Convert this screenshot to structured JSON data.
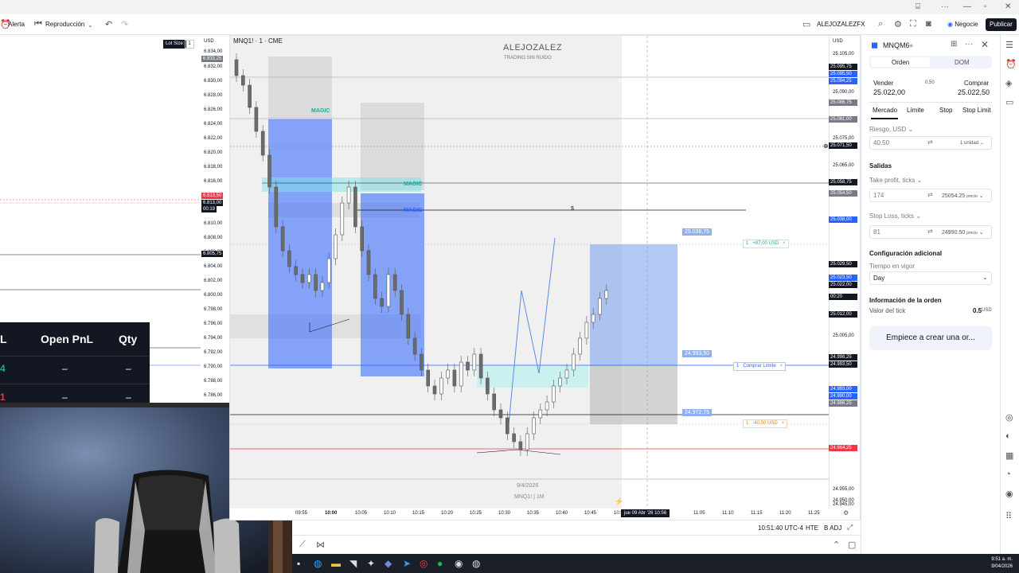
{
  "toolbar": {
    "alert_label": "Alerta",
    "replay_label": "Reproducción",
    "account_label": "ALEJOZALEZFX",
    "trade_label": "Negocie",
    "publish_label": "Publicar"
  },
  "left_chart": {
    "lot_label": "Lot Size:",
    "lot_value": "1",
    "currency": "USD",
    "prices": [
      "6.834,00",
      "6.832,00",
      "6.830,00",
      "6.828,00",
      "6.826,00",
      "6.824,00",
      "6.822,00",
      "6.820,00",
      "6.818,00",
      "6.816,00",
      "6.810,00",
      "6.808,00",
      "6.806,00",
      "6.804,00",
      "6.802,00",
      "6.800,00",
      "6.798,00",
      "6.796,00",
      "6.794,00",
      "6.792,00",
      "6.790,00",
      "6.788,00",
      "6.786,00"
    ],
    "tags": {
      "top": "6.833,25",
      "red": "6.813,50",
      "last": "6.813,00",
      "countdown": "00:19",
      "black": "6.805,75"
    },
    "pnl": {
      "col1": "L",
      "col2": "Open PnL",
      "col3": "Qty",
      "row1": [
        "4",
        "–",
        "–"
      ],
      "row2": [
        "1",
        "–",
        "–"
      ]
    }
  },
  "main_chart": {
    "title": "MNQ1! · 1 · CME",
    "watermark_title": "ALEJOZALEZ",
    "watermark_sub": "TRADING SIN RUIDO",
    "watermark_date": "9/4/2026",
    "watermark_symbol": "MNQ1! | 1M",
    "currency": "USD",
    "zone_labels": [
      "MAGIC",
      "MAGIC",
      "MAGIC"
    ],
    "level_label": "$",
    "price_labels": {
      "target": "25.036,75",
      "entry": "24.993,50",
      "stop": "24.972,75"
    },
    "order_labels": {
      "tp_qty": "1",
      "tp_text": "+87,00 USD",
      "limit_qty": "1",
      "limit_text": "Comprar Límite",
      "sl_qty": "1",
      "sl_text": "-40,50 USD",
      "close": "×"
    },
    "axis_prices": [
      "25.105,00",
      "25.090,00",
      "25.075,00",
      "25.065,00",
      "25.030,00",
      "25.020,00",
      "25.005,00",
      "24.955,00",
      "24.950,00",
      "24.945,00"
    ],
    "axis_tags": [
      {
        "text": "25.095,75",
        "color": "#131722"
      },
      {
        "text": "25.095,50",
        "color": "#2962ff"
      },
      {
        "text": "25.094,25",
        "color": "#2962ff"
      },
      {
        "text": "25.086,75",
        "color": "#787b86"
      },
      {
        "text": "25.081,00",
        "color": "#787b86"
      },
      {
        "text": "25.071,50",
        "color": "#131722"
      },
      {
        "text": "25.058,75",
        "color": "#131722"
      },
      {
        "text": "25.054,50",
        "color": "#787b86"
      },
      {
        "text": "25.038,00",
        "color": "#2962ff"
      },
      {
        "text": "25.029,50",
        "color": "#131722"
      },
      {
        "text": "25.023,50",
        "color": "#2962ff"
      },
      {
        "text": "25.022,00",
        "color": "#131722"
      },
      {
        "text": "25.012,00",
        "color": "#131722"
      },
      {
        "text": "24.998,25",
        "color": "#131722"
      },
      {
        "text": "24.993,50",
        "color": "#131722"
      },
      {
        "text": "24.993,00",
        "color": "#2962ff"
      },
      {
        "text": "24.990,00",
        "color": "#2962ff"
      },
      {
        "text": "24.986,25",
        "color": "#787b86"
      },
      {
        "text": "24.964,25",
        "color": "#f23645"
      }
    ],
    "countdown": "00:20",
    "time_labels": [
      "09:55",
      "10:00",
      "10:05",
      "10:10",
      "10:15",
      "10:20",
      "10:25",
      "10:30",
      "10:35",
      "10:40",
      "10:45",
      "10:50",
      "11:05",
      "11:10",
      "11:15",
      "11:20",
      "11:25"
    ],
    "cursor_time": "jue 09 Abr '26   10:56",
    "status_time": "10:51:40 UTC-4",
    "status_session": "HTE",
    "status_adj": "B ADJ"
  },
  "order_panel": {
    "symbol": "MNQM6",
    "tab_order": "Orden",
    "tab_dom": "DOM",
    "sell_label": "Vender",
    "buy_label": "Comprar",
    "spread": "0,50",
    "sell_price": "25.022,00",
    "buy_price": "25.022,50",
    "order_types": [
      "Mercado",
      "Límite",
      "Stop",
      "Stop Limit"
    ],
    "risk_label": "Riesgo, USD",
    "risk_value": "40.50",
    "risk_unit": "1 unidad",
    "exits_label": "Salidas",
    "tp_label": "Take profit, ticks",
    "tp_value": "174",
    "tp_price": "25054.25",
    "price_word": "precio",
    "sl_label": "Stop Loss, ticks",
    "sl_value": "81",
    "sl_price": "24990.50",
    "extra_label": "Configuración adicional",
    "tif_label": "Tiempo en vigor",
    "tif_value": "Day",
    "info_label": "Información de la orden",
    "tick_label": "Valor del tick",
    "tick_value": "0.5",
    "tick_unit": "USD",
    "cta": "Empiece a crear una or..."
  },
  "taskbar": {
    "time": "9:51 a. m.",
    "date": "9/04/2026"
  }
}
